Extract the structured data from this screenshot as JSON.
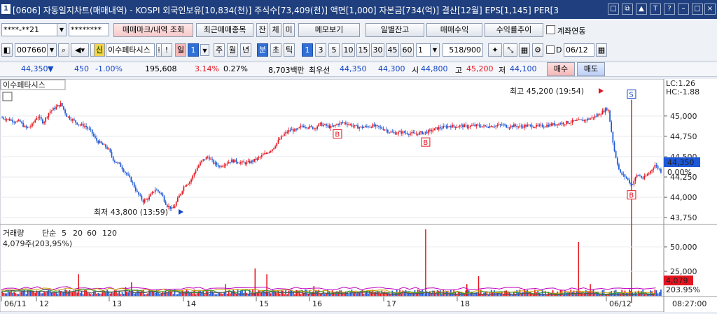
{
  "titlebar": {
    "badge": "1",
    "text": "[0606] 자동일지차트(매매내역) - KOSPI 외국인보유[10,834(천)] 주식수[73,409(천)] 액면[1,000] 자본금[734(억)] 결산[12월] EPS[1,145] PER[3",
    "buttons": [
      "□",
      "⧉",
      "▲",
      "T",
      "?",
      "–",
      "□",
      "×"
    ]
  },
  "toolbar1": {
    "account": "****-**21",
    "password": "********",
    "btn_trade_mark": "매매마크/내역 조회",
    "btn_recent": "최근매매종목",
    "btn_jan": "잔",
    "btn_che": "체",
    "btn_mi": "미",
    "btn_memo": "메모보기",
    "btn_daily": "일별잔고",
    "btn_profit": "매매수익",
    "btn_rate": "수익률추이",
    "chk_link": "계좌연동"
  },
  "toolbar2": {
    "code": "007660",
    "shin": "신",
    "stock_name": "이수페타시스",
    "excl": "!",
    "il": "일",
    "il_num": "1",
    "ju": "주",
    "wol": "월",
    "nyeon": "년",
    "bun": "분",
    "cho": "초",
    "tik": "틱",
    "minutes": [
      "1",
      "3",
      "5",
      "10",
      "15",
      "30",
      "45",
      "60"
    ],
    "n_value": "1",
    "count": "518",
    "total": "/900",
    "d_label": "D",
    "date": "06/12"
  },
  "infobar": {
    "price": "44,350",
    "arrow": "▼",
    "change": "450",
    "pct": "-1.00%",
    "volume": "195,608",
    "v1": "3.14%",
    "v2": "0.27%",
    "amount": "8,703백만",
    "best_label": "최우선",
    "best_sell": "44,350",
    "best_buy": "44,300",
    "open_label": "시",
    "open": "44,800",
    "high_label": "고",
    "high": "45,200",
    "low_label": "저",
    "low": "44,100",
    "buy_btn": "매수",
    "sell_btn": "매도"
  },
  "chart_data": {
    "type": "candlestick",
    "title": "이수페타시스",
    "colors": {
      "up": "#e8131b",
      "down": "#1d58d8"
    },
    "price": {
      "ylim": [
        43700,
        45300
      ],
      "yticks": [
        "45,000",
        "44,750",
        "44,500",
        "44,250",
        "44,000",
        "43,750"
      ],
      "values": [
        44980,
        44960,
        44940,
        44930,
        44850,
        44880,
        45000,
        44920,
        45050,
        45100,
        45150,
        45000,
        44950,
        44900,
        44880,
        44820,
        44700,
        44650,
        44600,
        44450,
        44400,
        44300,
        44200,
        44050,
        43950,
        44000,
        44100,
        44050,
        43900,
        43850,
        44000,
        44150,
        44200,
        44350,
        44450,
        44500,
        44420,
        44380,
        44420,
        44450,
        44440,
        44420,
        44430,
        44460,
        44500,
        44550,
        44600,
        44700,
        44780,
        44830,
        44820,
        44880,
        44870,
        44850,
        44900,
        44880,
        44860,
        44900,
        44920,
        44900,
        44870,
        44860,
        44870,
        44880,
        44860,
        44840,
        44800,
        44790,
        44800,
        44790,
        44780,
        44790,
        44800,
        44820,
        44850,
        44860,
        44880,
        44870,
        44880,
        44870,
        44880,
        44880,
        44870,
        44880,
        44880,
        44890,
        44870,
        44880,
        44870,
        44880,
        44880,
        44870,
        44880,
        44890,
        44900,
        44910,
        44920,
        44930,
        44940,
        44950,
        44970,
        45000,
        45050,
        45100,
        44600,
        44300,
        44250,
        44150,
        44280,
        44230,
        44300,
        44400,
        44320
      ],
      "last": "44,350",
      "last_pct": "0.00%",
      "lc": "LC:1.26",
      "hc": "HC:-1.88",
      "high_note": "최고 45,200 (19:54)",
      "low_note": "최저 43,800 (13:59)",
      "markers": [
        {
          "label": "B",
          "idx": 57
        },
        {
          "label": "B",
          "idx": 72
        },
        {
          "label": "B",
          "idx": 107
        },
        {
          "label": "S",
          "idx": 107
        }
      ]
    },
    "volume": {
      "legend": [
        "거래량",
        "단순",
        "5",
        "20",
        "60",
        "120"
      ],
      "legend_colors": [
        "#000000",
        "#c000c0",
        "#c000c0",
        "#c8a000",
        "#2a9a2a",
        "#555555"
      ],
      "info": "4,079주(203,95%)",
      "ylim": [
        0,
        70000
      ],
      "yticks": [
        "50,000",
        "25,000"
      ],
      "last": "4,079",
      "last_pct": "203.95%",
      "spikes": [
        {
          "i": 13,
          "v": 22000
        },
        {
          "i": 21,
          "v": 9000
        },
        {
          "i": 22,
          "v": 14000
        },
        {
          "i": 38,
          "v": 12000
        },
        {
          "i": 43,
          "v": 28000
        },
        {
          "i": 45,
          "v": 22000
        },
        {
          "i": 53,
          "v": 10000
        },
        {
          "i": 72,
          "v": 68000
        },
        {
          "i": 79,
          "v": 12000
        },
        {
          "i": 81,
          "v": 20000
        },
        {
          "i": 98,
          "v": 55000
        },
        {
          "i": 100,
          "v": 12000
        },
        {
          "i": 107,
          "v": 6000
        },
        {
          "i": 170,
          "v": 10000
        }
      ]
    },
    "x": {
      "labels": [
        "06/11",
        "12",
        "13",
        "14",
        "15",
        "16",
        "17",
        "18",
        "06/12"
      ],
      "time": "08:27:00"
    }
  }
}
